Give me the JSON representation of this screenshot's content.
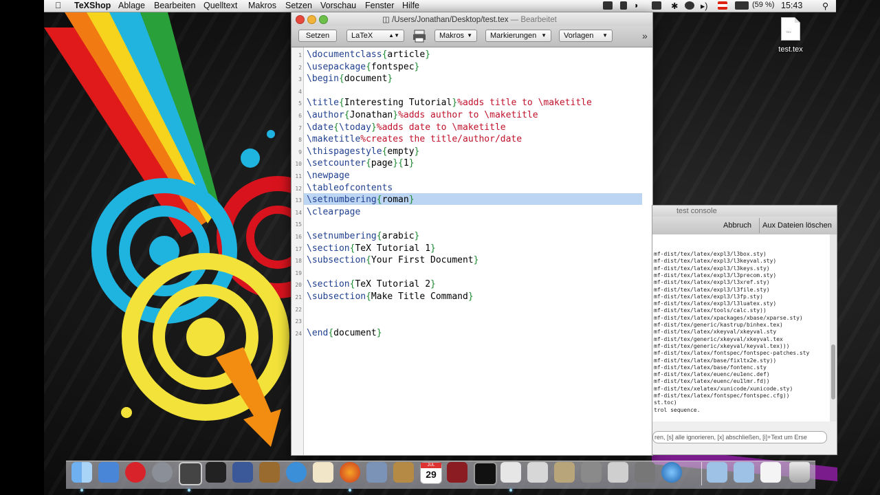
{
  "menubar": {
    "app_name": "TeXShop",
    "items": [
      "Ablage",
      "Bearbeiten",
      "Quelltext",
      "Makros",
      "Setzen",
      "Vorschau",
      "Fenster",
      "Hilfe"
    ],
    "battery": "(59 %)",
    "clock": "15:43"
  },
  "editor": {
    "title_path": "/Users/Jonathan/Desktop/test.tex",
    "title_state": "— Bearbeitet",
    "toolbar": {
      "typeset_label": "Setzen",
      "engine_label": "LaTeX",
      "macros_label": "Makros",
      "marks_label": "Markierungen",
      "templates_label": "Vorlagen",
      "overflow_label": "»"
    },
    "lines": [
      {
        "n": "1",
        "segments": [
          {
            "t": "\\documentclass",
            "c": "cmd"
          },
          {
            "t": "{",
            "c": "brace"
          },
          {
            "t": "article",
            "c": ""
          },
          {
            "t": "}",
            "c": "brace"
          }
        ]
      },
      {
        "n": "2",
        "segments": [
          {
            "t": "\\usepackage",
            "c": "cmd"
          },
          {
            "t": "{",
            "c": "brace"
          },
          {
            "t": "fontspec",
            "c": ""
          },
          {
            "t": "}",
            "c": "brace"
          }
        ]
      },
      {
        "n": "3",
        "segments": [
          {
            "t": "\\begin",
            "c": "cmd"
          },
          {
            "t": "{",
            "c": "brace"
          },
          {
            "t": "document",
            "c": ""
          },
          {
            "t": "}",
            "c": "brace"
          }
        ]
      },
      {
        "n": "4",
        "segments": []
      },
      {
        "n": "5",
        "segments": [
          {
            "t": "\\title",
            "c": "cmd"
          },
          {
            "t": "{",
            "c": "brace"
          },
          {
            "t": "Interesting Tutorial",
            "c": ""
          },
          {
            "t": "}",
            "c": "brace"
          },
          {
            "t": "%adds title to \\maketitle",
            "c": "cmt"
          }
        ]
      },
      {
        "n": "6",
        "segments": [
          {
            "t": "\\author",
            "c": "cmd"
          },
          {
            "t": "{",
            "c": "brace"
          },
          {
            "t": "Jonathan",
            "c": ""
          },
          {
            "t": "}",
            "c": "brace"
          },
          {
            "t": "%adds author to \\maketitle",
            "c": "cmt"
          }
        ]
      },
      {
        "n": "7",
        "segments": [
          {
            "t": "\\date",
            "c": "cmd"
          },
          {
            "t": "{",
            "c": "brace"
          },
          {
            "t": "\\today",
            "c": "cmd"
          },
          {
            "t": "}",
            "c": "brace"
          },
          {
            "t": "%adds date to \\maketitle",
            "c": "cmt"
          }
        ]
      },
      {
        "n": "8",
        "segments": [
          {
            "t": "\\maketitle",
            "c": "cmd"
          },
          {
            "t": "%creates the title/author/date",
            "c": "cmt"
          }
        ]
      },
      {
        "n": "9",
        "segments": [
          {
            "t": "\\thispagestyle",
            "c": "cmd"
          },
          {
            "t": "{",
            "c": "brace"
          },
          {
            "t": "empty",
            "c": ""
          },
          {
            "t": "}",
            "c": "brace"
          }
        ]
      },
      {
        "n": "10",
        "segments": [
          {
            "t": "\\setcounter",
            "c": "cmd"
          },
          {
            "t": "{",
            "c": "brace"
          },
          {
            "t": "page",
            "c": ""
          },
          {
            "t": "}{",
            "c": "brace"
          },
          {
            "t": "1",
            "c": ""
          },
          {
            "t": "}",
            "c": "brace"
          }
        ]
      },
      {
        "n": "11",
        "segments": [
          {
            "t": "\\newpage",
            "c": "cmd"
          }
        ]
      },
      {
        "n": "12",
        "segments": [
          {
            "t": "\\tableofcontents",
            "c": "cmd"
          }
        ]
      },
      {
        "n": "13",
        "segments": [
          {
            "t": "\\setnumbering",
            "c": "cmd"
          },
          {
            "t": "{",
            "c": "brace"
          },
          {
            "t": "roman",
            "c": ""
          },
          {
            "t": "}",
            "c": "brace"
          }
        ]
      },
      {
        "n": "14",
        "segments": [
          {
            "t": "\\clearpage",
            "c": "cmd"
          }
        ]
      },
      {
        "n": "15",
        "segments": []
      },
      {
        "n": "16",
        "segments": [
          {
            "t": "\\setnumbering",
            "c": "cmd"
          },
          {
            "t": "{",
            "c": "brace"
          },
          {
            "t": "arabic",
            "c": ""
          },
          {
            "t": "}",
            "c": "brace"
          }
        ]
      },
      {
        "n": "17",
        "segments": [
          {
            "t": "\\section",
            "c": "cmd"
          },
          {
            "t": "{",
            "c": "brace"
          },
          {
            "t": "TeX Tutorial 1",
            "c": ""
          },
          {
            "t": "}",
            "c": "brace"
          }
        ]
      },
      {
        "n": "18",
        "segments": [
          {
            "t": "\\subsection",
            "c": "cmd"
          },
          {
            "t": "{",
            "c": "brace"
          },
          {
            "t": "Your First Document",
            "c": ""
          },
          {
            "t": "}",
            "c": "brace"
          }
        ]
      },
      {
        "n": "19",
        "segments": []
      },
      {
        "n": "20",
        "segments": [
          {
            "t": "\\section",
            "c": "cmd"
          },
          {
            "t": "{",
            "c": "brace"
          },
          {
            "t": "TeX Tutorial 2",
            "c": ""
          },
          {
            "t": "}",
            "c": "brace"
          }
        ]
      },
      {
        "n": "21",
        "segments": [
          {
            "t": "\\subsection",
            "c": "cmd"
          },
          {
            "t": "{",
            "c": "brace"
          },
          {
            "t": "Make Title Command",
            "c": ""
          },
          {
            "t": "}",
            "c": "brace"
          }
        ]
      },
      {
        "n": "22",
        "segments": []
      },
      {
        "n": "23",
        "segments": []
      },
      {
        "n": "24",
        "segments": [
          {
            "t": "\\end",
            "c": "cmd"
          },
          {
            "t": "{",
            "c": "brace"
          },
          {
            "t": "document",
            "c": ""
          },
          {
            "t": "}",
            "c": "brace"
          }
        ]
      }
    ]
  },
  "console": {
    "title": "test console",
    "abort_label": "Abbruch",
    "clear_aux_label": "Aux Dateien löschen",
    "lines": [
      "mf-dist/tex/latex/expl3/l3box.sty)",
      "mf-dist/tex/latex/expl3/l3keyval.sty)",
      "mf-dist/tex/latex/expl3/l3keys.sty)",
      "mf-dist/tex/latex/expl3/l3precom.sty)",
      "mf-dist/tex/latex/expl3/l3xref.sty)",
      "mf-dist/tex/latex/expl3/l3file.sty)",
      "mf-dist/tex/latex/expl3/l3fp.sty)",
      "mf-dist/tex/latex/expl3/l3luatex.sty)",
      "mf-dist/tex/latex/tools/calc.sty))",
      "mf-dist/tex/latex/xpackages/xbase/xparse.sty)",
      "mf-dist/tex/generic/kastrup/binhex.tex)",
      "mf-dist/tex/latex/xkeyval/xkeyval.sty",
      "mf-dist/tex/generic/xkeyval/xkeyval.tex",
      "mf-dist/tex/generic/xkeyval/keyval.tex)))",
      "mf-dist/tex/latex/fontspec/fontspec-patches.sty",
      "mf-dist/tex/latex/base/fixltx2e.sty))",
      "mf-dist/tex/latex/base/fontenc.sty",
      "mf-dist/tex/latex/euenc/eu1enc.def)",
      "mf-dist/tex/latex/euenc/eu1lmr.fd))",
      "mf-dist/tex/xelatex/xunicode/xunicode.sty)",
      "mf-dist/tex/latex/fontspec/fontspec.cfg))",
      "st.toc)",
      "trol sequence."
    ],
    "input_hint": "ren, [s] alle ignorieren, [x] abschließen, [i]+Text um Erse"
  },
  "desktop": {
    "file_label": "test.tex",
    "file_icon_tag": "TEX"
  },
  "dock": {
    "calendar_day": "29",
    "calendar_month": "JUL"
  },
  "colors": {
    "command": "#1f3f8f",
    "brace": "#1c8a30",
    "comment": "#c0102a",
    "selection": "#bcd5f3"
  }
}
